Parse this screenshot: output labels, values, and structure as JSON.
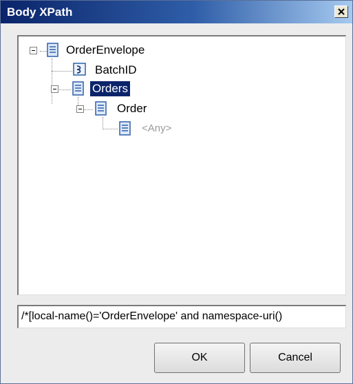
{
  "window": {
    "title": "Body XPath",
    "close_icon": "close-icon"
  },
  "tree": {
    "nodes": [
      {
        "label": "OrderEnvelope",
        "icon": "schema-node-icon",
        "expanded": true,
        "selected": false
      },
      {
        "label": "BatchID",
        "icon": "field-element-icon",
        "expanded": false,
        "selected": false
      },
      {
        "label": "Orders",
        "icon": "schema-node-icon",
        "expanded": true,
        "selected": true
      },
      {
        "label": "Order",
        "icon": "schema-node-icon",
        "expanded": true,
        "selected": false
      },
      {
        "label": "<Any>",
        "icon": "schema-node-icon",
        "expanded": false,
        "selected": false
      }
    ]
  },
  "xpath": {
    "value": "/*[local-name()='OrderEnvelope' and namespace-uri()"
  },
  "buttons": {
    "ok_label": "OK",
    "cancel_label": "Cancel"
  },
  "colors": {
    "selection": "#0a246a",
    "title_gradient_start": "#0a246a",
    "title_gradient_end": "#a6caf0"
  }
}
